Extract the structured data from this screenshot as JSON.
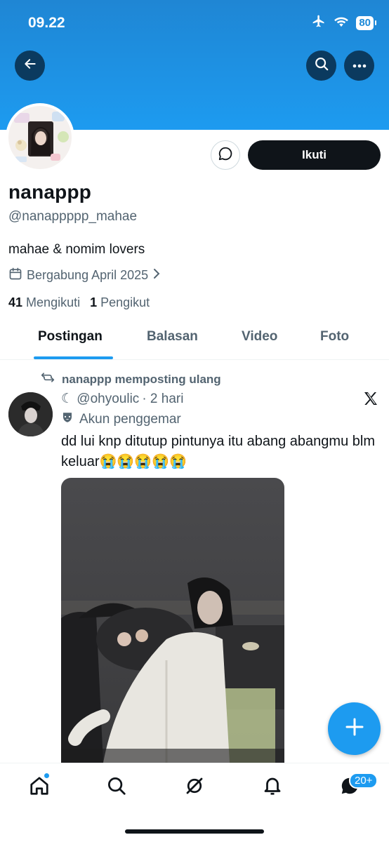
{
  "status_bar": {
    "time": "09.22",
    "battery": "80"
  },
  "profile": {
    "display_name": "nanappp",
    "handle": "@nanappppp_mahae",
    "bio": "mahae & nomim lovers",
    "joined": "Bergabung April 2025",
    "following_count": "41",
    "following_label": "Mengikuti",
    "followers_count": "1",
    "followers_label": "Pengikut",
    "follow_button": "Ikuti"
  },
  "tabs": [
    {
      "label": "Postingan",
      "active": true
    },
    {
      "label": "Balasan",
      "active": false
    },
    {
      "label": "Video",
      "active": false
    },
    {
      "label": "Foto",
      "active": false
    }
  ],
  "post": {
    "repost_label": "nanappp memposting ulang",
    "author_handle": "☾ @ohyoulic",
    "time": "· 2 hari",
    "fan_label": "Akun penggemar",
    "text": "dd lui knp ditutup pintunya itu abang abangmu blm keluar😭😭😭😭😭"
  },
  "nav": {
    "notifications_badge": "20+"
  },
  "colors": {
    "accent": "#1d9bf0",
    "dark": "#0f1419",
    "muted": "#536471"
  },
  "icons": [
    "back-arrow-icon",
    "search-icon",
    "more-icon",
    "message-icon",
    "calendar-icon",
    "chevron-right-icon",
    "repost-icon",
    "x-logo-icon",
    "mask-icon",
    "plus-icon",
    "home-icon",
    "explore-icon",
    "grok-icon",
    "bell-icon",
    "messages-icon"
  ]
}
